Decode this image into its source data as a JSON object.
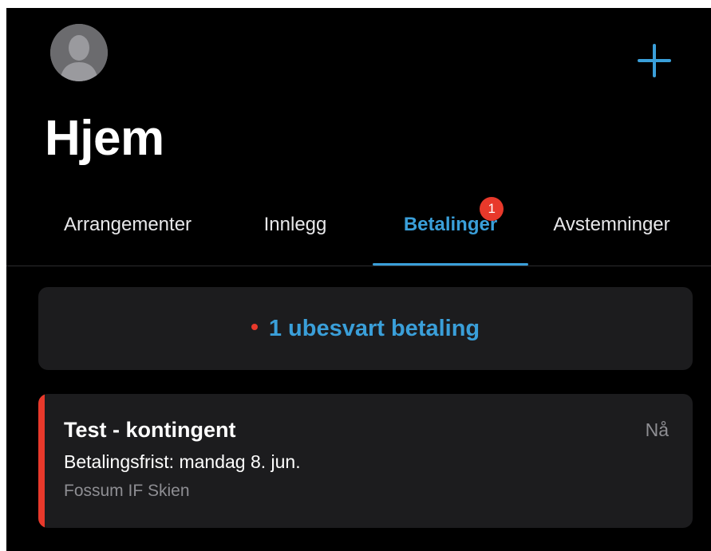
{
  "header": {
    "avatar_icon": "person-placeholder-icon",
    "add_icon": "plus-icon",
    "title": "Hjem"
  },
  "tabs": [
    {
      "label": "Arrangementer",
      "active": false
    },
    {
      "label": "Innlegg",
      "active": false
    },
    {
      "label": "Betalinger",
      "active": true,
      "badge": "1"
    },
    {
      "label": "Avstemninger",
      "active": false
    }
  ],
  "banner": {
    "text": "1 ubesvart betaling"
  },
  "payment": {
    "title": "Test - kontingent",
    "time": "Nå",
    "deadline": "Betalingsfrist: mandag 8. jun.",
    "organization": "Fossum IF Skien"
  },
  "colors": {
    "accent": "#3a9fd9",
    "alert": "#e8392b",
    "background": "#000000",
    "card": "#1c1c1e",
    "secondary_text": "#8e8e93"
  }
}
